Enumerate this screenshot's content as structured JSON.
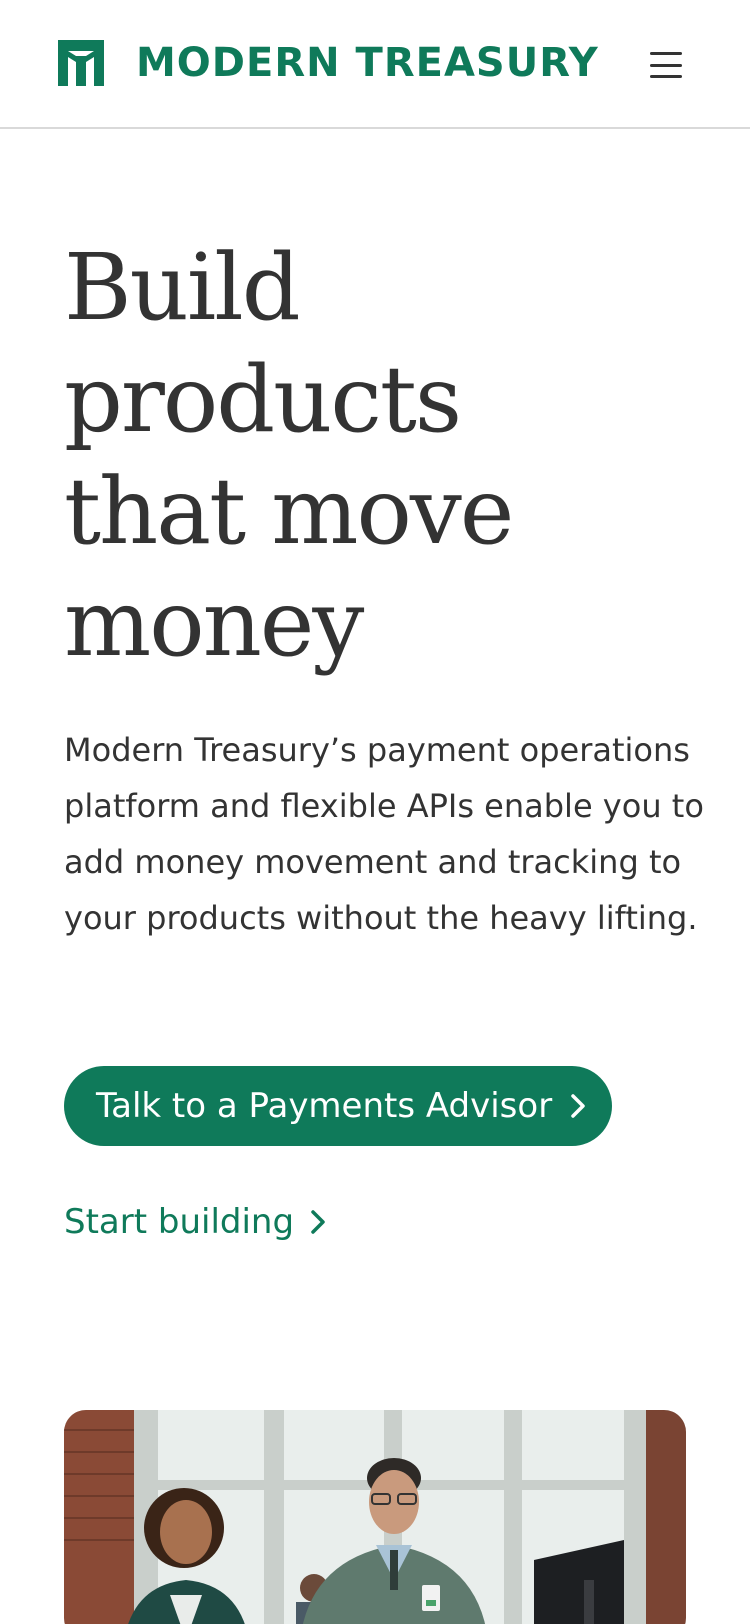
{
  "brand": {
    "name": "MODERN TREASURY",
    "logo_icon": "modern-treasury-logo-mark",
    "color": "#0f7a5a"
  },
  "header": {
    "menu_icon": "hamburger-menu-icon"
  },
  "hero": {
    "title_lines": [
      "Build",
      "products",
      "that move",
      "money"
    ],
    "description": "Modern Treasury’s payment operations platform and flexible APIs enable you to add money movement and tracking to your products without the heavy lifting.",
    "primary_cta": {
      "label": "Talk to a Payments Advisor",
      "icon": "chevron-right-icon",
      "background": "#0f7a5a",
      "text_color": "#ffffff"
    },
    "secondary_cta": {
      "label": "Start building",
      "icon": "chevron-right-icon"
    },
    "media": {
      "subject": "photo-of-two-people-in-office"
    }
  },
  "colors": {
    "text": "#333333",
    "accent": "#0f7a5a",
    "divider": "#d9d9d9"
  }
}
